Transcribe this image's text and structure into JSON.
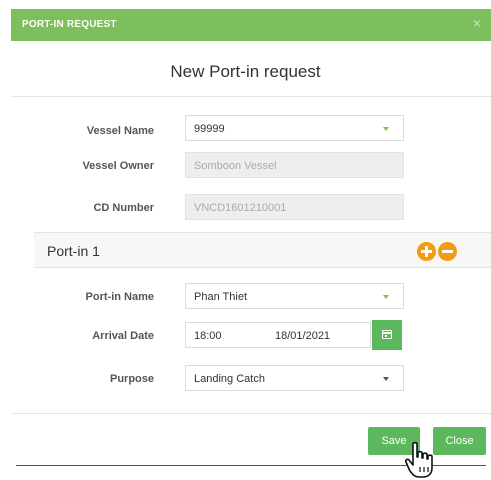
{
  "header": {
    "title": "PORT-IN REQUEST",
    "close_glyph": "×"
  },
  "modal": {
    "title": "New Port-in request"
  },
  "form": {
    "vessel_name": {
      "label": "Vessel Name",
      "value": "99999"
    },
    "vessel_owner": {
      "label": "Vessel Owner",
      "value": "Somboon Vessel"
    },
    "cd_number": {
      "label": "CD Number",
      "value": "VNCD1601210001"
    }
  },
  "port_in": {
    "section_title": "Port-in 1",
    "port_in_name": {
      "label": "Port-in Name",
      "value": "Phan Thiet"
    },
    "arrival_date": {
      "label": "Arrival Date",
      "time": "18:00",
      "date": "18/01/2021"
    },
    "purpose": {
      "label": "Purpose",
      "value": "Landing Catch"
    }
  },
  "footer": {
    "save_label": "Save",
    "close_label": "Close"
  },
  "colors": {
    "header_green": "#7dbf5c",
    "button_green": "#5cb85c",
    "orange_accent": "#f39c12"
  },
  "icons": {
    "add": "plus-circle-icon",
    "remove": "minus-circle-icon",
    "calendar": "calendar-icon",
    "cursor": "hand-pointer-icon",
    "close": "close-icon"
  }
}
